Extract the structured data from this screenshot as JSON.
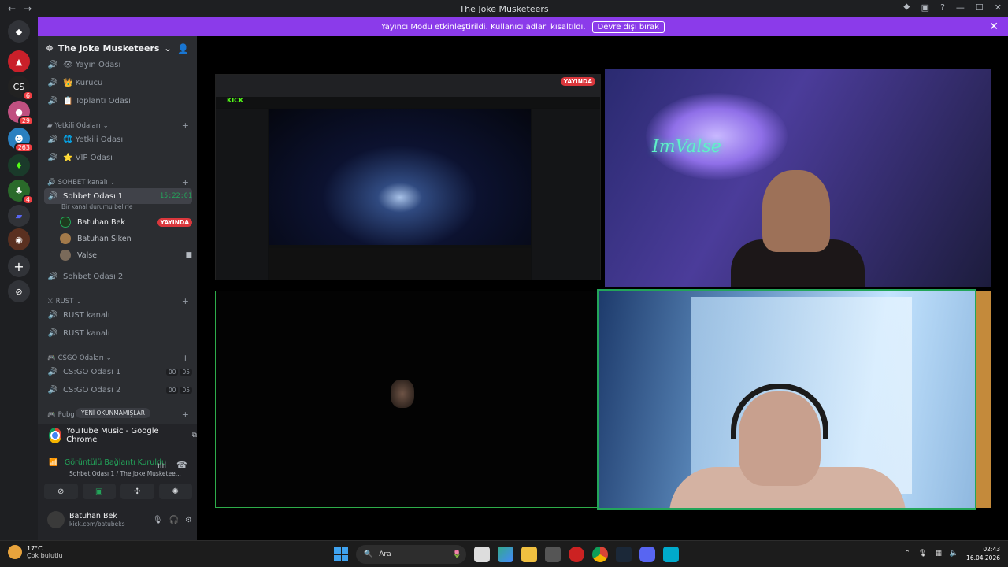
{
  "window": {
    "title": "The Joke Musketeers",
    "back": "←",
    "forward": "→",
    "controls": [
      "⯁",
      "▣",
      "?",
      "—",
      "☐",
      "✕"
    ]
  },
  "banner": {
    "text": "Yayıncı Modu etkinleştirildi. Kullanıcı adları kısaltıldı.",
    "button": "Devre dışı bırak",
    "close": "✕"
  },
  "servers": [
    {
      "label": "◆",
      "badge": ""
    },
    {
      "label": "▲",
      "badge": ""
    },
    {
      "label": "CS",
      "badge": "6"
    },
    {
      "label": "●",
      "badge": "29"
    },
    {
      "label": "☻",
      "badge": "263"
    },
    {
      "label": "♦",
      "badge": ""
    },
    {
      "label": "♣",
      "badge": "4"
    },
    {
      "label": "▰",
      "badge": ""
    },
    {
      "label": "◉",
      "badge": ""
    }
  ],
  "guild": {
    "name": "The Joke Musketeers"
  },
  "channels": [
    {
      "icon": "🔊",
      "name": "👁 Yayın Odası"
    },
    {
      "icon": "🔊",
      "name": "👑 Kurucu"
    },
    {
      "icon": "🔊",
      "name": "📋 Toplantı Odası"
    }
  ],
  "category_yetkili": {
    "name": "Yetkili Odaları",
    "items": [
      "🌐 Yetkili Odası",
      "⭐ VIP Odası"
    ]
  },
  "category_sohbet": {
    "name": "SOHBET kanalı"
  },
  "active_channel": {
    "name": "Sohbet Odası 1",
    "time": "15:22:01",
    "status": "Bir kanal durumu belirle"
  },
  "members": [
    {
      "name": "Batuhan Bek",
      "live": "YAYINDA"
    },
    {
      "name": "Batuhan Siken",
      "live": ""
    },
    {
      "name": "Valse",
      "live": ""
    }
  ],
  "sohbet2": "Sohbet Odası 2",
  "category_rust": {
    "name": "RUST",
    "items": [
      "RUST kanalı",
      "RUST kanalı"
    ]
  },
  "category_csgo": {
    "name": "CSGO Odaları",
    "items": [
      {
        "name": "CS:GO Odası 1",
        "a": "00",
        "b": "05"
      },
      {
        "name": "CS:GO Odası 2",
        "a": "00",
        "b": "05"
      }
    ]
  },
  "category_pubg": {
    "name": "Pubg"
  },
  "new_unread": "YENİ OKUNMAMIŞLAR",
  "activity": {
    "app": "YouTube Music - Google Chrome"
  },
  "voice": {
    "status": "Görüntülü Bağlantı Kuruldu",
    "sub": "Sohbet Odası 1 / The Joke Musketee..."
  },
  "user": {
    "name": "Batuhan Bek",
    "status": "kick.com/batubeks"
  },
  "stage": {
    "live_tag": "YAYINDA",
    "cam_text": "ImValse"
  },
  "taskbar": {
    "temp": "17°C",
    "weather": "Çok bulutlu",
    "search": "Ara",
    "time": "02:43",
    "date": "16.04.2026"
  },
  "colors": {
    "accent": "#8b3bea",
    "live": "#da373c",
    "online": "#23a55a"
  }
}
